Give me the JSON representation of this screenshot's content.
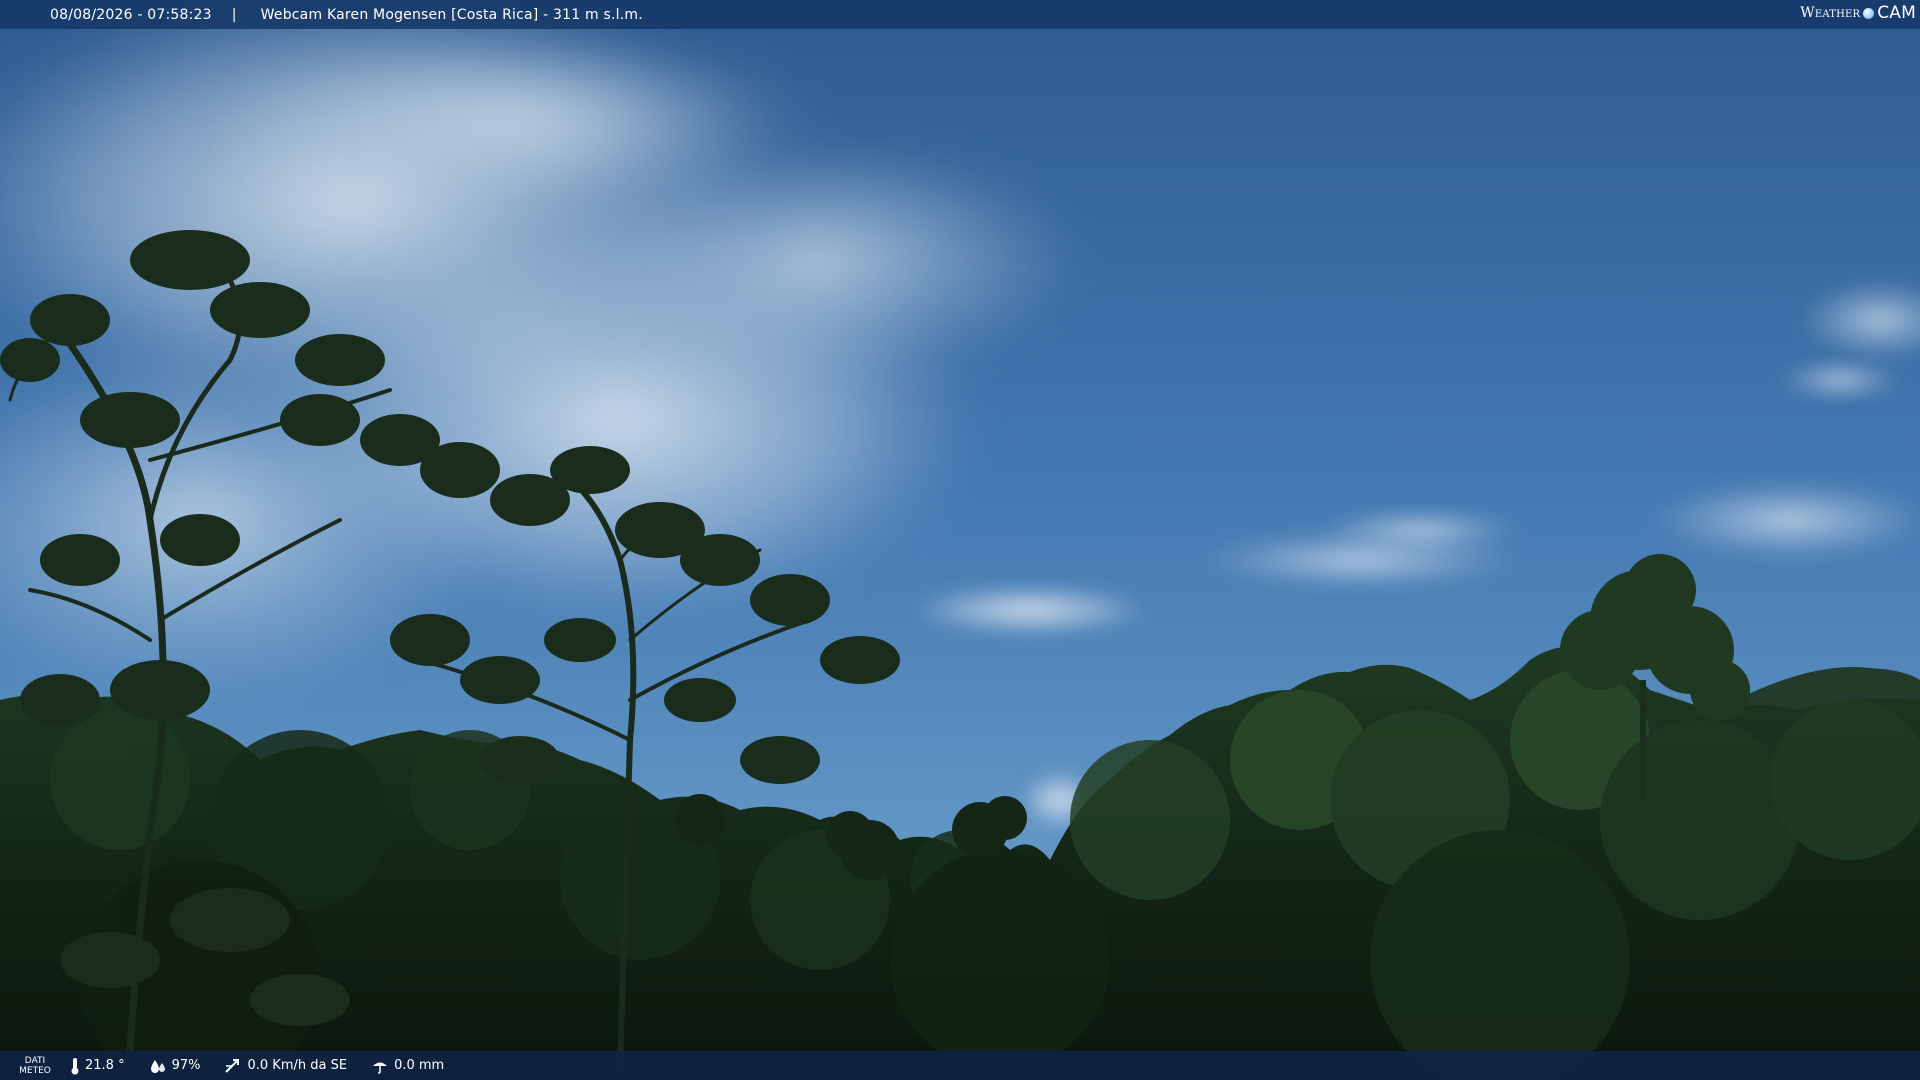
{
  "header": {
    "datetime": "08/08/2026 - 07:58:23",
    "separator": "|",
    "title": "Webcam Karen Mogensen [Costa Rica]  - 311 m s.l.m.",
    "logo_left": "Weather",
    "logo_right": "CAM"
  },
  "footer": {
    "label_line1": "DATI",
    "label_line2": "METEO",
    "temperature": "21.8 °",
    "humidity": "97%",
    "wind": "0.0 Km/h da SE",
    "rain": "0.0 mm"
  },
  "icons": {
    "temperature": "thermometer-icon",
    "humidity": "humidity-drop-icon",
    "wind": "wind-icon",
    "rain": "rain-gauge-icon"
  },
  "colors": {
    "sky_top": "#2f5f95",
    "sky_mid": "#4a7fb8",
    "sky_horizon": "#6a9cc6",
    "cloud": "#cfdceb",
    "foliage_dark": "#0f1d12",
    "foliage_mid": "#1c3420",
    "foliage_light": "#2f4f2c",
    "bar_top": "#163868",
    "bar_bottom": "#0e2446"
  }
}
